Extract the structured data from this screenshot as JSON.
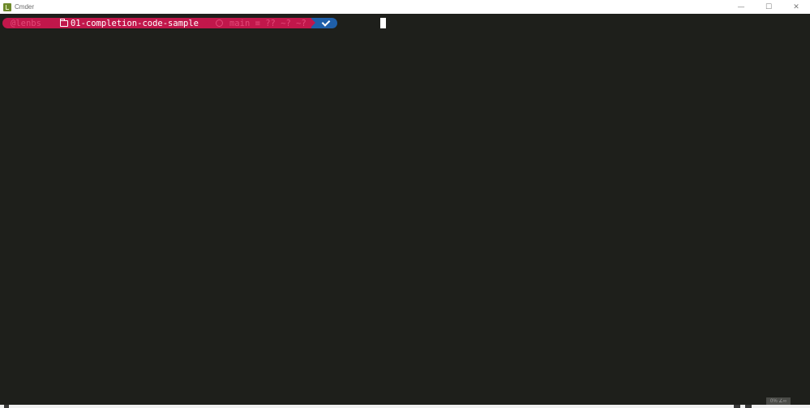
{
  "window": {
    "title": "Cmder",
    "minimize_glyph": "—",
    "maximize_glyph": "☐",
    "close_glyph": "✕"
  },
  "prompt": {
    "user": "@lenbs",
    "path": "01-completion-code-sample",
    "branch_glyph": "",
    "git_status": "main ≡ ?? ~? ~?",
    "status_ok": true
  },
  "colors": {
    "console_bg": "#1e1f1b",
    "segment_red": "#c1174b",
    "segment_blue": "#1f5fa9",
    "dim_text": "#e14a78"
  },
  "icons": {
    "app": "cmder-app-icon",
    "folder": "folder-icon",
    "git": "github-icon",
    "ok": "check-icon"
  },
  "statusbar": {
    "widget_text": "0% ∠∞"
  }
}
